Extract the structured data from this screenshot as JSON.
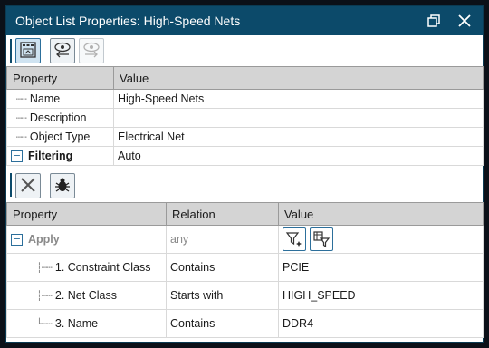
{
  "window": {
    "title": "Object List Properties: High-Speed Nets",
    "restore_icon": "restore-icon",
    "close_icon": "close-icon"
  },
  "toolbar1": {
    "buttons": [
      {
        "icon": "object-list-icon",
        "state": "active"
      },
      {
        "icon": "view-prev-icon",
        "state": "enabled"
      },
      {
        "icon": "view-next-icon",
        "state": "disabled"
      }
    ]
  },
  "props": {
    "col_property": "Property",
    "col_value": "Value",
    "rows": [
      {
        "label": "Name",
        "value": "High-Speed Nets"
      },
      {
        "label": "Description",
        "value": ""
      },
      {
        "label": "Object Type",
        "value": "Electrical Net"
      }
    ],
    "filtering": {
      "label": "Filtering",
      "value": "Auto",
      "expand": "−"
    }
  },
  "toolbar2": {
    "buttons": [
      {
        "icon": "clear-filter-icon"
      },
      {
        "icon": "bug-icon"
      }
    ]
  },
  "filter": {
    "col_property": "Property",
    "col_relation": "Relation",
    "col_value": "Value",
    "apply": {
      "label": "Apply",
      "relation": "any",
      "expand": "−"
    },
    "value_buttons": [
      "filter-sparkle-icon",
      "filter-table-icon"
    ],
    "conditions": [
      {
        "label": "1. Constraint Class",
        "relation": "Contains",
        "value": "PCIE"
      },
      {
        "label": "2. Net Class",
        "relation": "Starts with",
        "value": "HIGH_SPEED"
      },
      {
        "label": "3. Name",
        "relation": "Contains",
        "value": "DDR4"
      }
    ]
  },
  "colors": {
    "titlebar": "#0c4a6a",
    "accent": "#2c6f9b",
    "header": "#d4d4d4"
  }
}
